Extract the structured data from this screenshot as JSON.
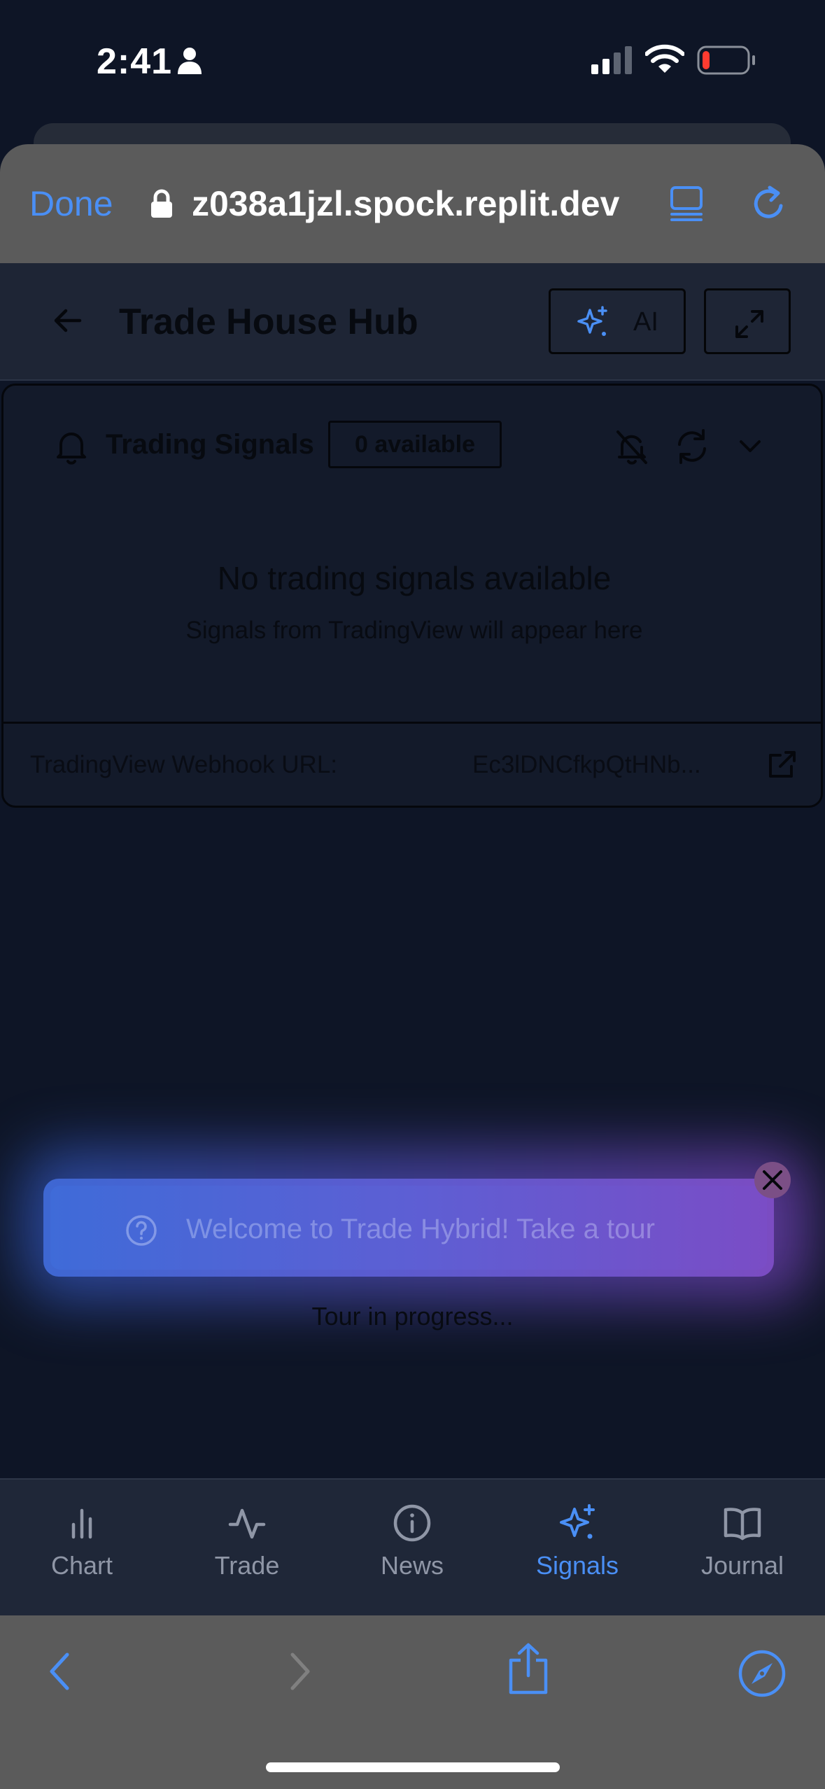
{
  "status_bar": {
    "time": "2:41"
  },
  "browser": {
    "done_label": "Done",
    "url": "z038a1jzl.spock.replit.dev"
  },
  "header": {
    "title": "Trade House Hub",
    "ai_label": "AI"
  },
  "signals": {
    "title": "Trading Signals",
    "count_badge": "0 available",
    "empty_title": "No trading signals available",
    "empty_subtitle": "Signals from TradingView will appear here",
    "webhook_label": "TradingView Webhook URL:",
    "webhook_value": "Ec3lDNCfkpQtHNb..."
  },
  "tour": {
    "banner_text": "Welcome to Trade Hybrid! Take a tour",
    "status_text": "Tour in progress..."
  },
  "tabs": [
    {
      "label": "Chart",
      "icon": "bar-chart-icon",
      "active": false
    },
    {
      "label": "Trade",
      "icon": "activity-icon",
      "active": false
    },
    {
      "label": "News",
      "icon": "info-icon",
      "active": false
    },
    {
      "label": "Signals",
      "icon": "sparkles-icon",
      "active": true
    },
    {
      "label": "Journal",
      "icon": "book-open-icon",
      "active": false
    }
  ],
  "colors": {
    "accent": "#4a8ff5",
    "tab_inactive": "#8f96a6",
    "app_background": "#131a2a",
    "browser_chrome": "#5b5b5b",
    "tour_gradient_start": "#3f6bd8",
    "tour_gradient_end": "#7a4dc6",
    "battery_low": "#ff3b30"
  }
}
